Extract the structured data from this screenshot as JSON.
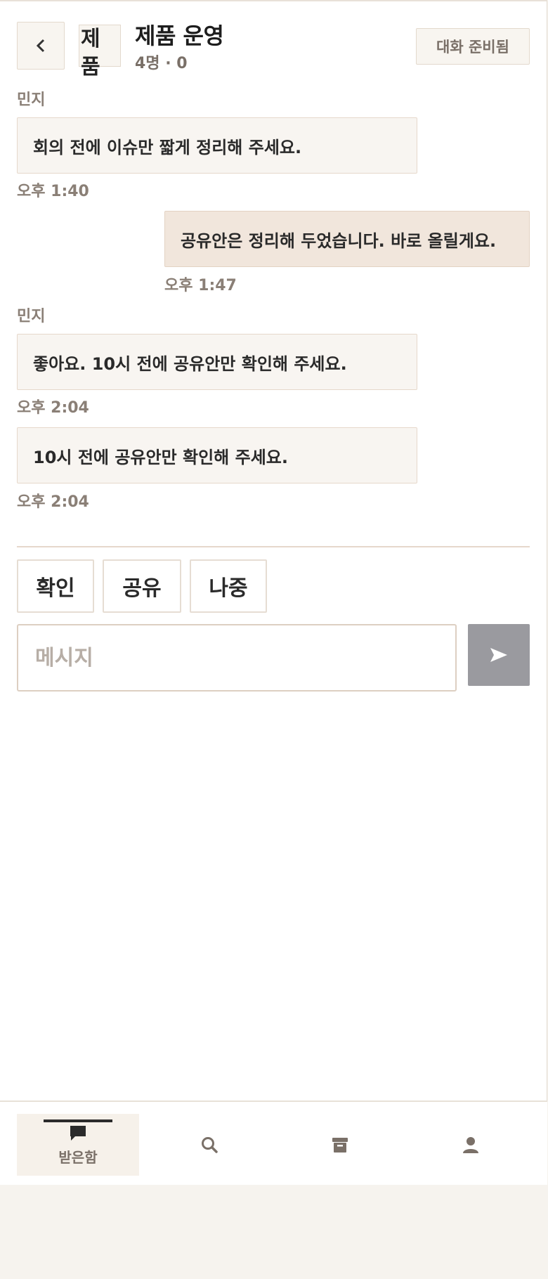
{
  "header": {
    "avatar_text": "제품",
    "title": "제품 운영",
    "subtitle": "4명 · 0",
    "status": "대화 준비됨"
  },
  "messages": [
    {
      "sender": "민지",
      "text": "회의 전에 이슈만 짧게 정리해 주세요.",
      "time": "오후 1:40",
      "mine": false
    },
    {
      "sender": "",
      "text": "공유안은 정리해 두었습니다. 바로 올릴게요.",
      "time": "오후 1:47",
      "mine": true
    },
    {
      "sender": "민지",
      "text": "좋아요. 10시 전에 공유안만 확인해 주세요.",
      "time": "오후 2:04",
      "mine": false
    },
    {
      "sender": "",
      "text": "10시 전에 공유안만 확인해 주세요.",
      "time": "오후 2:04",
      "mine": false
    }
  ],
  "quick_replies": [
    "확인",
    "공유",
    "나중"
  ],
  "composer": {
    "placeholder": "메시지",
    "value": ""
  },
  "bottom_nav": [
    {
      "label": "받은함",
      "icon": "chat-icon",
      "active": true
    },
    {
      "label": "",
      "icon": "search-icon",
      "active": false
    },
    {
      "label": "",
      "icon": "archive-icon",
      "active": false
    },
    {
      "label": "",
      "icon": "profile-icon",
      "active": false
    }
  ],
  "colors": {
    "accent_bubble": "#f1e6dc",
    "send_button": "#9a9a9f",
    "border": "#e6d8cb"
  }
}
